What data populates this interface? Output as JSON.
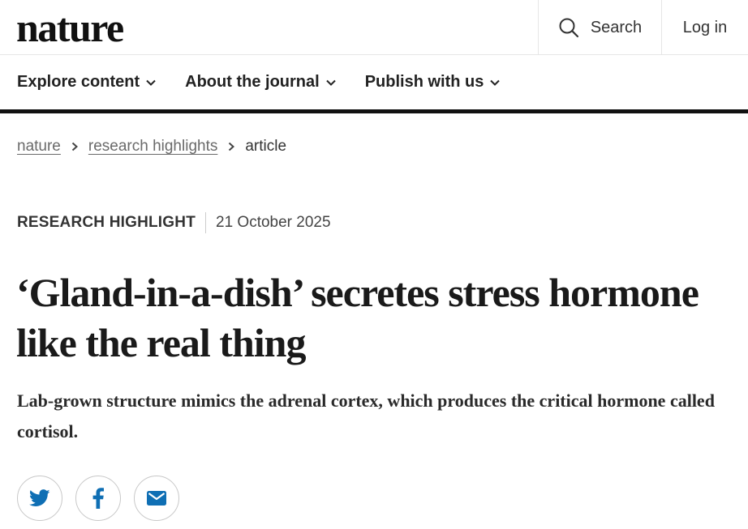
{
  "header": {
    "logo": "nature",
    "search_label": "Search",
    "login_label": "Log in"
  },
  "nav": {
    "items": [
      {
        "label": "Explore content"
      },
      {
        "label": "About the journal"
      },
      {
        "label": "Publish with us"
      }
    ]
  },
  "breadcrumb": {
    "items": [
      "nature",
      "research highlights"
    ],
    "current": "article"
  },
  "article": {
    "type": "RESEARCH HIGHLIGHT",
    "date": "21 October 2025",
    "title": "‘Gland-in-a-dish’ secretes stress hormone like the real thing",
    "standfirst": "Lab-grown structure mimics the adrenal cortex, which produces the critical hormone called cortisol."
  },
  "share": {
    "buttons": [
      "twitter-icon",
      "facebook-icon",
      "email-icon"
    ]
  },
  "colors": {
    "accent": "#0f6fb4",
    "text": "#222222",
    "nav_rule": "#111111"
  }
}
